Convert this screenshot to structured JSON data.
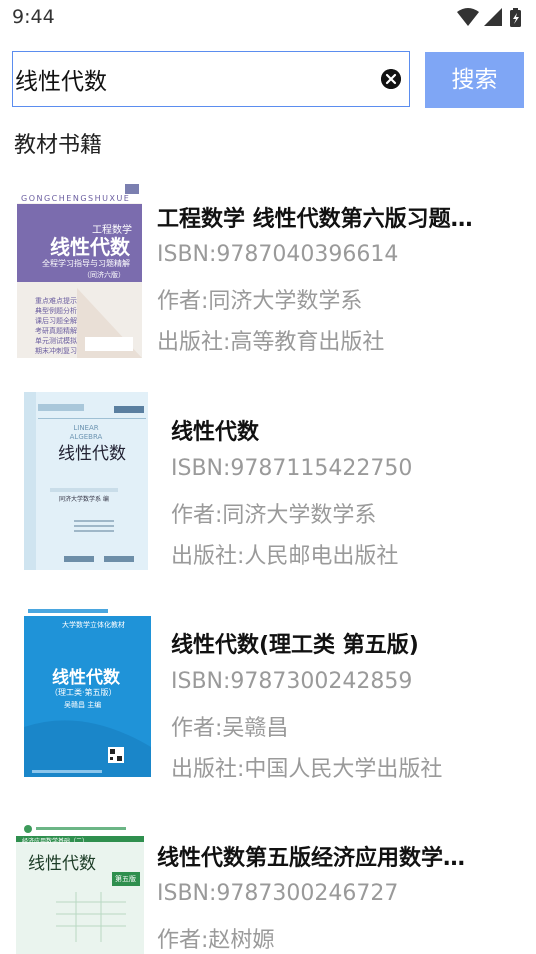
{
  "status_bar": {
    "time": "9:44",
    "icons": [
      "wifi-icon",
      "cell-signal-icon",
      "battery-icon"
    ]
  },
  "search": {
    "value": "线性代数",
    "placeholder": "",
    "button_label": "搜索"
  },
  "section": {
    "title": "教材书籍"
  },
  "books": [
    {
      "title": "工程数学 线性代数第六版习题…",
      "isbn": "ISBN:9787040396614",
      "author": "作者:同济大学数学系",
      "publisher": "出版社:高等教育出版社",
      "cover": {
        "top_text": "GONGCHENGSHUXUE",
        "series": "工程数学",
        "main": "线性代数",
        "sub": "全程学习指导与习题精解",
        "edition": "（同济六版）",
        "side_items": [
          "重点难点提示",
          "典型例题分析",
          "课后习题全解",
          "考研真题精解",
          "单元测试模拟",
          "期末冲刺复习"
        ]
      }
    },
    {
      "title": "线性代数",
      "isbn": "ISBN:9787115422750",
      "author": "作者:同济大学数学系",
      "publisher": "出版社:人民邮电出版社",
      "cover": {
        "top_text": "LINEAR ALGEBRA",
        "main": "线性代数",
        "sub": "同济大学数学系 编"
      }
    },
    {
      "title": "线性代数(理工类 第五版)",
      "isbn": "ISBN:9787300242859",
      "author": "作者:吴赣昌",
      "publisher": "出版社:中国人民大学出版社",
      "cover": {
        "series": "大学数学立体化教材",
        "main": "线性代数",
        "sub": "（理工类·第五版）",
        "editor": "吴赣昌 主编"
      }
    },
    {
      "title": "线性代数第五版经济应用数学…",
      "isbn": "ISBN:9787300246727",
      "author": "作者:赵树嫄",
      "publisher": "",
      "cover": {
        "series": "经济应用数学基础（二）",
        "main": "线性代数",
        "edition": "第五版"
      }
    }
  ],
  "colors": {
    "accent_border": "#5b8def",
    "search_button": "#7fa6f5",
    "muted_text": "#9a9a9a"
  }
}
